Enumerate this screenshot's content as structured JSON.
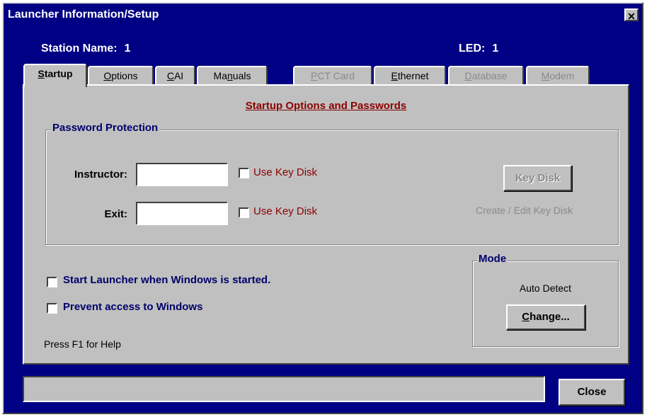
{
  "window": {
    "title": "Launcher Information/Setup",
    "close_glyph": "✕"
  },
  "info": {
    "station_label": "Station Name:",
    "station_value": "1",
    "led_label": "LED:",
    "led_value": "1"
  },
  "tabs": [
    {
      "label": "Startup",
      "mnemonic": "S",
      "rest": "tartup",
      "state": "active"
    },
    {
      "label": "Options",
      "mnemonic": "O",
      "rest": "ptions",
      "state": "enabled"
    },
    {
      "label": "CAI",
      "mnemonic": "C",
      "rest": "AI",
      "state": "enabled"
    },
    {
      "label": "Manuals",
      "mnemonic": "n",
      "pre": "Ma",
      "rest": "uals",
      "state": "enabled"
    },
    {
      "label": "PCT Card",
      "mnemonic": "P",
      "rest": "CT Card",
      "state": "disabled"
    },
    {
      "label": "Ethernet",
      "mnemonic": "E",
      "rest": "thernet",
      "state": "enabled"
    },
    {
      "label": "Database",
      "mnemonic": "D",
      "rest": "atabase",
      "state": "disabled"
    },
    {
      "label": "Modem",
      "mnemonic": "M",
      "rest": "odem",
      "state": "disabled"
    }
  ],
  "panel": {
    "heading": "Startup Options and Passwords",
    "password_group": {
      "label": "Password Protection",
      "instructor_label": "Instructor:",
      "instructor_value": "",
      "exit_label": "Exit:",
      "exit_value": "",
      "use_key_disk_label": "Use Key Disk",
      "key_disk_button": "Key Disk",
      "key_disk_hint": "Create / Edit Key Disk"
    },
    "start_launcher_label": "Start Launcher when Windows is started.",
    "prevent_access_label": "Prevent access to Windows",
    "help_text": "Press F1 for Help",
    "mode_group": {
      "label": "Mode",
      "value": "Auto Detect",
      "change_button": "Change..."
    }
  },
  "footer": {
    "status_text": "",
    "close_button": "Close"
  }
}
